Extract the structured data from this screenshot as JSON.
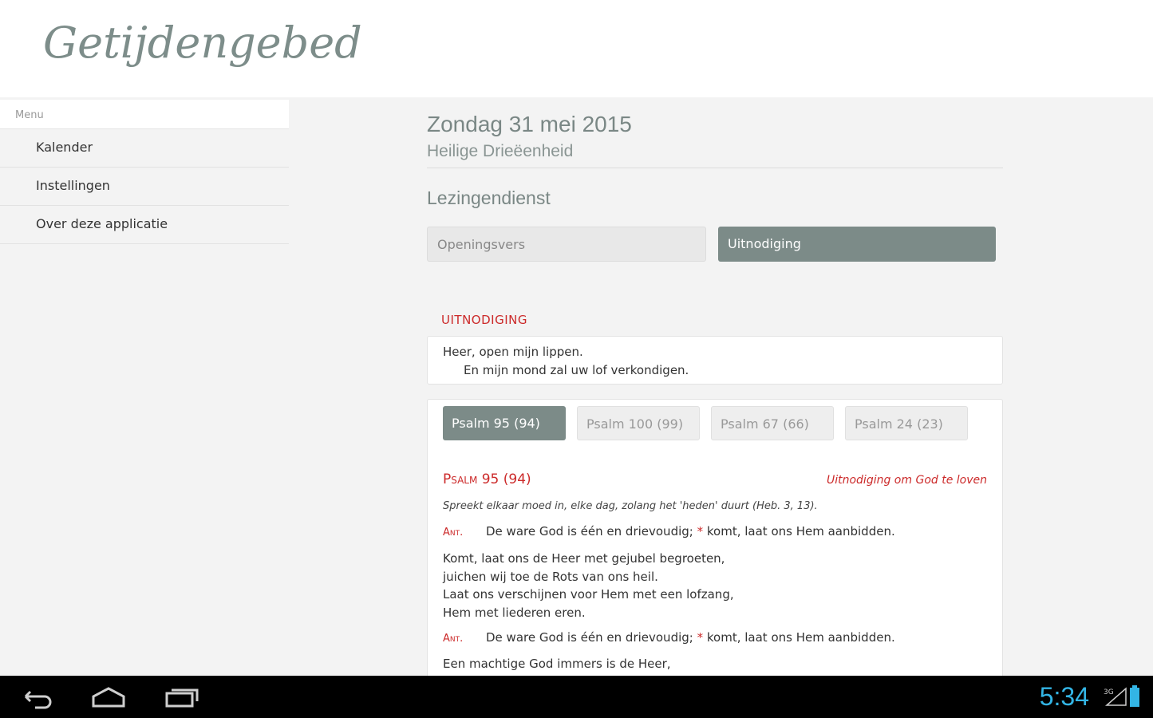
{
  "app": {
    "title": "Getijdengebed"
  },
  "sidebar": {
    "menu_label": "Menu",
    "items": [
      {
        "label": "Kalender"
      },
      {
        "label": "Instellingen"
      },
      {
        "label": "Over deze applicatie"
      }
    ]
  },
  "main": {
    "date": "Zondag 31 mei 2015",
    "feast": "Heilige Drieëenheid",
    "section": "Lezingendienst",
    "tabs": [
      {
        "label": "Openingsvers",
        "active": false
      },
      {
        "label": "Uitnodiging",
        "active": true
      }
    ]
  },
  "invitation": {
    "heading": "UITNODIGING",
    "line1": "Heer, open mijn lippen.",
    "line2": "En mijn mond zal uw lof verkondigen."
  },
  "psalm": {
    "tabs": [
      {
        "label": "Psalm 95 (94)",
        "active": true
      },
      {
        "label": "Psalm 100 (99)",
        "active": false
      },
      {
        "label": "Psalm 67 (66)",
        "active": false
      },
      {
        "label": "Psalm 24 (23)",
        "active": false
      }
    ],
    "title": "Psalm 95 (94)",
    "subtitle": "Uitnodiging om God te loven",
    "quote": "Spreekt elkaar moed in, elke dag, zolang het 'heden' duurt (Heb. 3, 13).",
    "antiphon_label": "Ant.",
    "antiphon_part1": "De ware God is één en drievoudig;",
    "antiphon_star": "*",
    "antiphon_part2": "komt, laat ons Hem aanbidden.",
    "verses": [
      "Komt, laat ons de Heer met gejubel begroeten,",
      "juichen wij toe de Rots van ons heil.",
      "Laat ons verschijnen voor Hem met een lofzang,",
      "Hem met liederen eren."
    ],
    "next_verse": "Een machtige God immers is de Heer,"
  },
  "statusbar": {
    "time": "5:34",
    "signal_label": "3G"
  },
  "colors": {
    "accent": "#7c8b88",
    "red": "#cc2a2a",
    "clock": "#33b5e5"
  }
}
